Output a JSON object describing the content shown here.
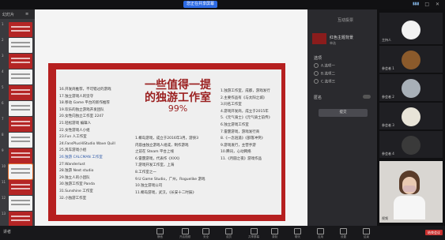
{
  "topbar": {
    "share_text": "您正在共享屏幕",
    "window_controls": "— □ ✕"
  },
  "ppt": {
    "toolbar_left": "幻灯片",
    "thumbs": [
      {
        "num": "1",
        "kind": "red"
      },
      {
        "num": "2",
        "kind": "white"
      },
      {
        "num": "3",
        "kind": "red"
      },
      {
        "num": "4",
        "kind": "white"
      },
      {
        "num": "5",
        "kind": "red"
      },
      {
        "num": "6",
        "kind": "white"
      },
      {
        "num": "7",
        "kind": "red"
      },
      {
        "num": "8",
        "kind": "white"
      },
      {
        "num": "9",
        "kind": "red"
      },
      {
        "num": "10",
        "kind": "white"
      },
      {
        "num": "11",
        "kind": "red"
      },
      {
        "num": "12",
        "kind": "white"
      },
      {
        "num": "13",
        "kind": "red"
      }
    ]
  },
  "slide": {
    "title_line1": "一些值得一提",
    "title_line2": "的独游工作室",
    "title_num": "99%",
    "left_col": [
      "16.开发商推荐，不可错过的游戏",
      "17.独立游戏人的坚守",
      "18.移动 Game 平台的新作推荐",
      "19.欢乐的独立游戏开发团队",
      "20.女性向独立工作室 2247",
      "21.轻松游戏 编辑人",
      "22.女性游戏人小组",
      "23.Fun 人工作室",
      "24.FansPlusHiStudio Wave Quill",
      "25.风车游戏小组",
      "26.独游 CALCMAN 工作室",
      "27.Wanderlust",
      "28.独游 Next studio",
      "29.独立人的小团队",
      "30.独游工作室 Panda",
      "31.Sunshine 工作室",
      "32.小独游工作室"
    ],
    "mid_col": [
      "1.椰岛游戏，成立于2016年3月，游侠3",
      "内容由独立游戏人组成，制作游戏",
      "之前在 Steam 平台上线",
      "6.雷霆游戏，代表作《XXX》",
      "7.游戏开发工作室，上海",
      "8.工作室之一",
      "9.U Game Studio，广州，Roguelike 游戏",
      "10.独立游戏公司",
      "11.椰岛游戏，武汉，《长安十二时辰》"
    ],
    "right_col": [
      "1.独游工作室，成都，游戏发行",
      "2.主要作品有《与太阳之城》",
      "3.同名工作室",
      "4.游戏开发商，成立于2015年",
      "5.《元气骑士》《元气骑士前传》",
      "6.独立游戏工作室",
      "7.雷霆游戏，游戏发行商",
      "8.《一念逍遥》《部落冲突》",
      "9.游戏发行，主营手游",
      "10.腾讯，心动网络",
      "11.《月圆之夜》游戏作品"
    ]
  },
  "panel": {
    "header": "互动投票",
    "card_title": "红色主题背景",
    "card_sub": "单选",
    "section_title": "选项",
    "options": [
      "A.选项一",
      "B.选项二",
      "C.选项三"
    ],
    "anon_label": "匿名",
    "submit_label": "提交"
  },
  "participants": [
    {
      "label": "主持人"
    },
    {
      "label": "参会者 1"
    },
    {
      "label": "参会者 2"
    },
    {
      "label": "参会者 3"
    },
    {
      "label": "参会者 4"
    },
    {
      "label": "参会者 5"
    },
    {
      "label": "视频"
    }
  ],
  "bottombar": {
    "left_text": "讲者",
    "items": [
      "静音",
      "开启视频",
      "安全",
      "成员",
      "共享屏幕",
      "录制",
      "聊天",
      "应用",
      "设置",
      "结束"
    ],
    "end_label": "结束会议"
  },
  "colors": {
    "slide_red": "#b62020",
    "title_red": "#9a1f1f",
    "panel_bg": "#2a2a2e"
  }
}
